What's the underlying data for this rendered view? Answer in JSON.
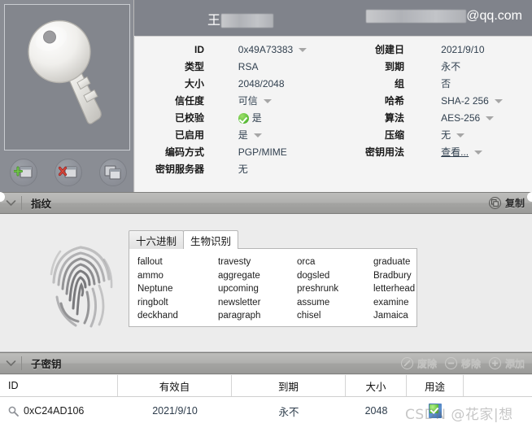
{
  "window": {
    "title_name_prefix": "王",
    "title_name_redacted": true,
    "email_domain": "@qq.com"
  },
  "key_image": {
    "icon": "key-icon"
  },
  "key_toolbar": {
    "buttons": [
      {
        "name": "add-key-button",
        "icon": "add-window-icon"
      },
      {
        "name": "delete-key-button",
        "icon": "delete-window-icon"
      },
      {
        "name": "copy-key-button",
        "icon": "duplicate-window-icon"
      }
    ]
  },
  "details": {
    "left": [
      {
        "label": "ID",
        "value": "0x49A73383",
        "caret": true,
        "check": false
      },
      {
        "label": "类型",
        "value": "RSA",
        "caret": false,
        "check": false
      },
      {
        "label": "大小",
        "value": "2048/2048",
        "caret": false,
        "check": false
      },
      {
        "label": "信任度",
        "value": "可信",
        "caret": true,
        "check": false
      },
      {
        "label": "已校验",
        "value": "是",
        "caret": false,
        "check": true
      },
      {
        "label": "已启用",
        "value": "是",
        "caret": true,
        "check": false
      },
      {
        "label": "编码方式",
        "value": "PGP/MIME",
        "caret": false,
        "check": false
      },
      {
        "label": "密钥服务器",
        "value": "无",
        "caret": false,
        "check": false
      }
    ],
    "right": [
      {
        "label": "创建日",
        "value": "2021/9/10",
        "caret": false,
        "underline": false
      },
      {
        "label": "到期",
        "value": "永不",
        "caret": false,
        "underline": false
      },
      {
        "label": "组",
        "value": "否",
        "caret": false,
        "underline": false
      },
      {
        "label": "哈希",
        "value": "SHA-2 256",
        "caret": true,
        "underline": false
      },
      {
        "label": "算法",
        "value": "AES-256",
        "caret": true,
        "underline": false
      },
      {
        "label": "压缩",
        "value": "无",
        "caret": true,
        "underline": false
      },
      {
        "label": "密钥用法",
        "value": "查看...",
        "caret": true,
        "underline": true
      }
    ]
  },
  "fingerprint_section": {
    "title": "指纹",
    "chevron": "chevron-down-icon",
    "copy_button": {
      "label": "复制",
      "icon": "copy-icon"
    },
    "tabs": [
      {
        "label": "十六进制",
        "active": false
      },
      {
        "label": "生物识别",
        "active": true
      }
    ],
    "biometric_words": [
      [
        "fallout",
        "travesty",
        "orca",
        "graduate"
      ],
      [
        "ammo",
        "aggregate",
        "dogsled",
        "Bradbury"
      ],
      [
        "Neptune",
        "upcoming",
        "preshrunk",
        "letterhead"
      ],
      [
        "ringbolt",
        "newsletter",
        "assume",
        "examine"
      ],
      [
        "deckhand",
        "paragraph",
        "chisel",
        "Jamaica"
      ]
    ]
  },
  "subkeys_section": {
    "title": "子密钥",
    "chevron": "chevron-down-icon",
    "actions": [
      {
        "label": "废除",
        "icon": "revoke-icon",
        "enabled": false
      },
      {
        "label": "移除",
        "icon": "minus-icon",
        "enabled": false
      },
      {
        "label": "添加",
        "icon": "plus-icon",
        "enabled": false
      }
    ],
    "columns": [
      "ID",
      "有效自",
      "到期",
      "大小",
      "用途",
      ""
    ],
    "rows": [
      {
        "id": "0xC24AD106",
        "valid_from": "2021/9/10",
        "expires": "永不",
        "size": "2048",
        "usage_icon": "certificate-icon"
      }
    ]
  },
  "watermark": {
    "text": "CSDN @花家|想"
  }
}
